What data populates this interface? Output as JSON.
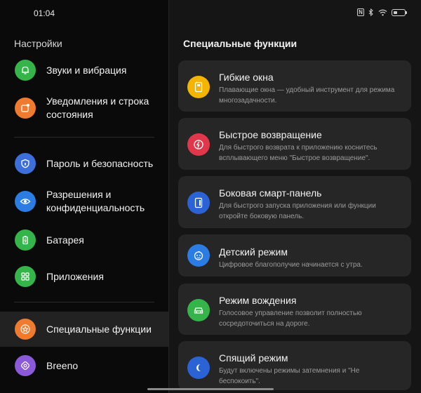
{
  "status_bar": {
    "time": "01:04"
  },
  "sidebar": {
    "title": "Настройки",
    "items": [
      {
        "label": "Звуки и вибрация",
        "color": "#35b44a",
        "icon": "bell-icon"
      },
      {
        "label": "Уведомления и строка состояния",
        "color": "#f07a2e",
        "icon": "notification-icon"
      },
      {
        "label": "Пароль и безопасность",
        "color": "#3d6fdb",
        "icon": "shield-icon"
      },
      {
        "label": "Разрешения и конфиденциальность",
        "color": "#2b7de3",
        "icon": "eye-icon"
      },
      {
        "label": "Батарея",
        "color": "#35b44a",
        "icon": "battery-icon"
      },
      {
        "label": "Приложения",
        "color": "#35b44a",
        "icon": "apps-grid-icon"
      },
      {
        "label": "Специальные функции",
        "color": "#f07a2e",
        "icon": "star-icon",
        "active": true
      },
      {
        "label": "Breeno",
        "color": "#8a5ad8",
        "icon": "breeno-icon"
      }
    ]
  },
  "main": {
    "title": "Специальные функции",
    "cards": [
      {
        "title": "Гибкие окна",
        "description": "Плавающие окна — удобный инструмент для режима многозадачности.",
        "color": "#f5b400",
        "icon": "floating-window-icon"
      },
      {
        "title": "Быстрое возвращение",
        "description": "Для быстрого возврата к приложению коснитесь всплывающего меню \"Быстрое возвращение\".",
        "color": "#e0384a",
        "icon": "lightning-icon"
      },
      {
        "title": "Боковая смарт-панель",
        "description": "Для быстрого запуска приложения или функции откройте боковую панель.",
        "color": "#2b63d6",
        "icon": "side-panel-icon"
      },
      {
        "title": "Детский режим",
        "description": "Цифровое благополучие начинается с утра.",
        "color": "#2b7de3",
        "icon": "kid-face-icon"
      },
      {
        "title": "Режим вождения",
        "description": "Голосовое управление позволит полностью сосредоточиться на дороге.",
        "color": "#35b44a",
        "icon": "car-icon"
      },
      {
        "title": "Спящий режим",
        "description": "Будут включены режимы затемнения и \"Не беспокоить\".",
        "color": "#2b63d6",
        "icon": "moon-icon"
      }
    ]
  }
}
